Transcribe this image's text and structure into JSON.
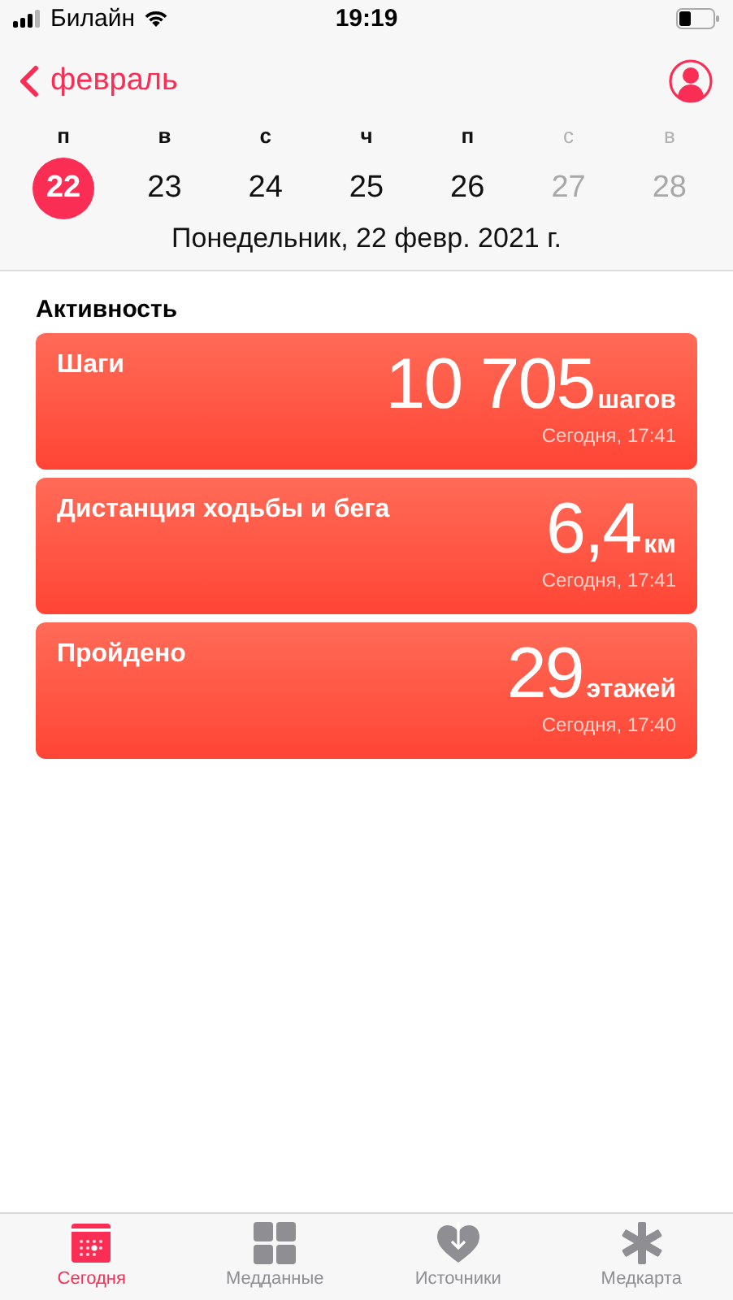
{
  "status_bar": {
    "carrier": "Билайн",
    "time": "19:19"
  },
  "nav": {
    "back": "февраль"
  },
  "week": [
    {
      "weekday": "п",
      "day": "22",
      "selected": true,
      "dimmed": false
    },
    {
      "weekday": "в",
      "day": "23",
      "selected": false,
      "dimmed": false
    },
    {
      "weekday": "с",
      "day": "24",
      "selected": false,
      "dimmed": false
    },
    {
      "weekday": "ч",
      "day": "25",
      "selected": false,
      "dimmed": false
    },
    {
      "weekday": "п",
      "day": "26",
      "selected": false,
      "dimmed": false
    },
    {
      "weekday": "с",
      "day": "27",
      "selected": false,
      "dimmed": true
    },
    {
      "weekday": "в",
      "day": "28",
      "selected": false,
      "dimmed": true
    }
  ],
  "date_title": "Понедельник, 22 февр. 2021 г.",
  "section": {
    "title": "Активность",
    "cards": [
      {
        "title": "Шаги",
        "value": "10 705",
        "unit": "шагов",
        "time": "Сегодня, 17:41"
      },
      {
        "title": "Дистанция ходьбы и бега",
        "value": "6,4",
        "unit": "км",
        "time": "Сегодня, 17:41"
      },
      {
        "title": "Пройдено",
        "value": "29",
        "unit": "этажей",
        "time": "Сегодня, 17:40"
      }
    ]
  },
  "tab_bar": [
    {
      "kind": "today",
      "label": "Сегодня",
      "selected": true
    },
    {
      "kind": "data",
      "label": "Медданные",
      "selected": false
    },
    {
      "kind": "sources",
      "label": "Источники",
      "selected": false
    },
    {
      "kind": "medid",
      "label": "Медкарта",
      "selected": false
    }
  ]
}
